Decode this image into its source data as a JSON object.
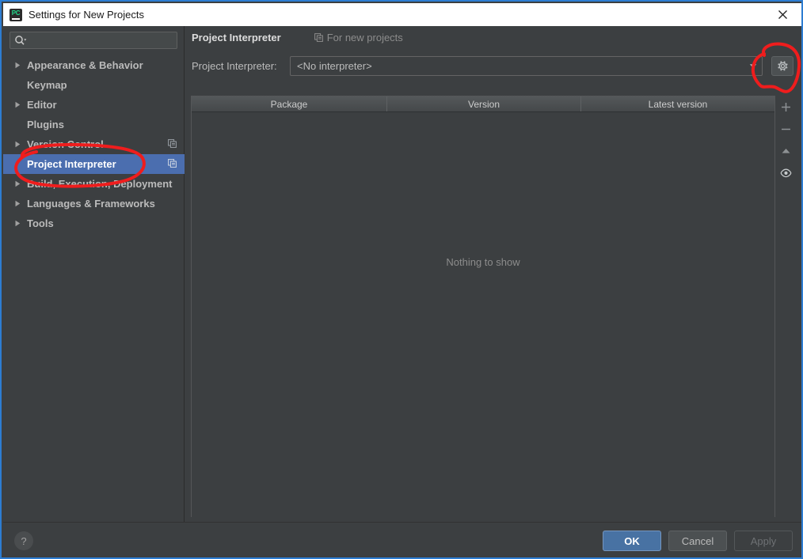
{
  "window": {
    "title": "Settings for New Projects",
    "app_icon": "pycharm-icon",
    "app_icon_text": "PC",
    "close_icon": "close-icon",
    "accent_border": "#2d7dd2"
  },
  "search": {
    "placeholder": "",
    "value": "",
    "icon": "search-icon"
  },
  "sidebar": {
    "items": [
      {
        "label": "Appearance & Behavior",
        "expandable": true,
        "selected": false,
        "copy_icon": false
      },
      {
        "label": "Keymap",
        "expandable": false,
        "selected": false,
        "copy_icon": false
      },
      {
        "label": "Editor",
        "expandable": true,
        "selected": false,
        "copy_icon": false
      },
      {
        "label": "Plugins",
        "expandable": false,
        "selected": false,
        "copy_icon": false
      },
      {
        "label": "Version Control",
        "expandable": true,
        "selected": false,
        "copy_icon": true
      },
      {
        "label": "Project Interpreter",
        "expandable": false,
        "selected": true,
        "copy_icon": true
      },
      {
        "label": "Build, Execution, Deployment",
        "expandable": true,
        "selected": false,
        "copy_icon": false
      },
      {
        "label": "Languages & Frameworks",
        "expandable": true,
        "selected": false,
        "copy_icon": false
      },
      {
        "label": "Tools",
        "expandable": true,
        "selected": false,
        "copy_icon": false
      }
    ],
    "selected_color": "#4b6eaf"
  },
  "main": {
    "page_title": "Project Interpreter",
    "scope_label": "For new projects",
    "scope_icon": "copy-icon",
    "interpreter_label": "Project Interpreter:",
    "interpreter_value": "<No interpreter>",
    "interpreter_dropdown_icon": "chevron-down-icon",
    "gear_icon": "gear-icon",
    "table": {
      "columns": [
        "Package",
        "Version",
        "Latest version"
      ],
      "rows": [],
      "empty_message": "Nothing to show"
    },
    "side_toolbar": [
      {
        "icon": "plus-icon",
        "name": "install-package-button"
      },
      {
        "icon": "minus-icon",
        "name": "uninstall-package-button"
      },
      {
        "icon": "arrow-up-icon",
        "name": "upgrade-package-button"
      },
      {
        "icon": "eye-icon",
        "name": "show-early-releases-button"
      }
    ]
  },
  "footer": {
    "help_label": "?",
    "ok_label": "OK",
    "cancel_label": "Cancel",
    "apply_label": "Apply"
  },
  "annotations": {
    "color": "#ef1d1d",
    "shapes": [
      {
        "name": "ellipse-around-project-interpreter"
      },
      {
        "name": "ellipse-around-interpreter-settings-gear"
      }
    ]
  }
}
